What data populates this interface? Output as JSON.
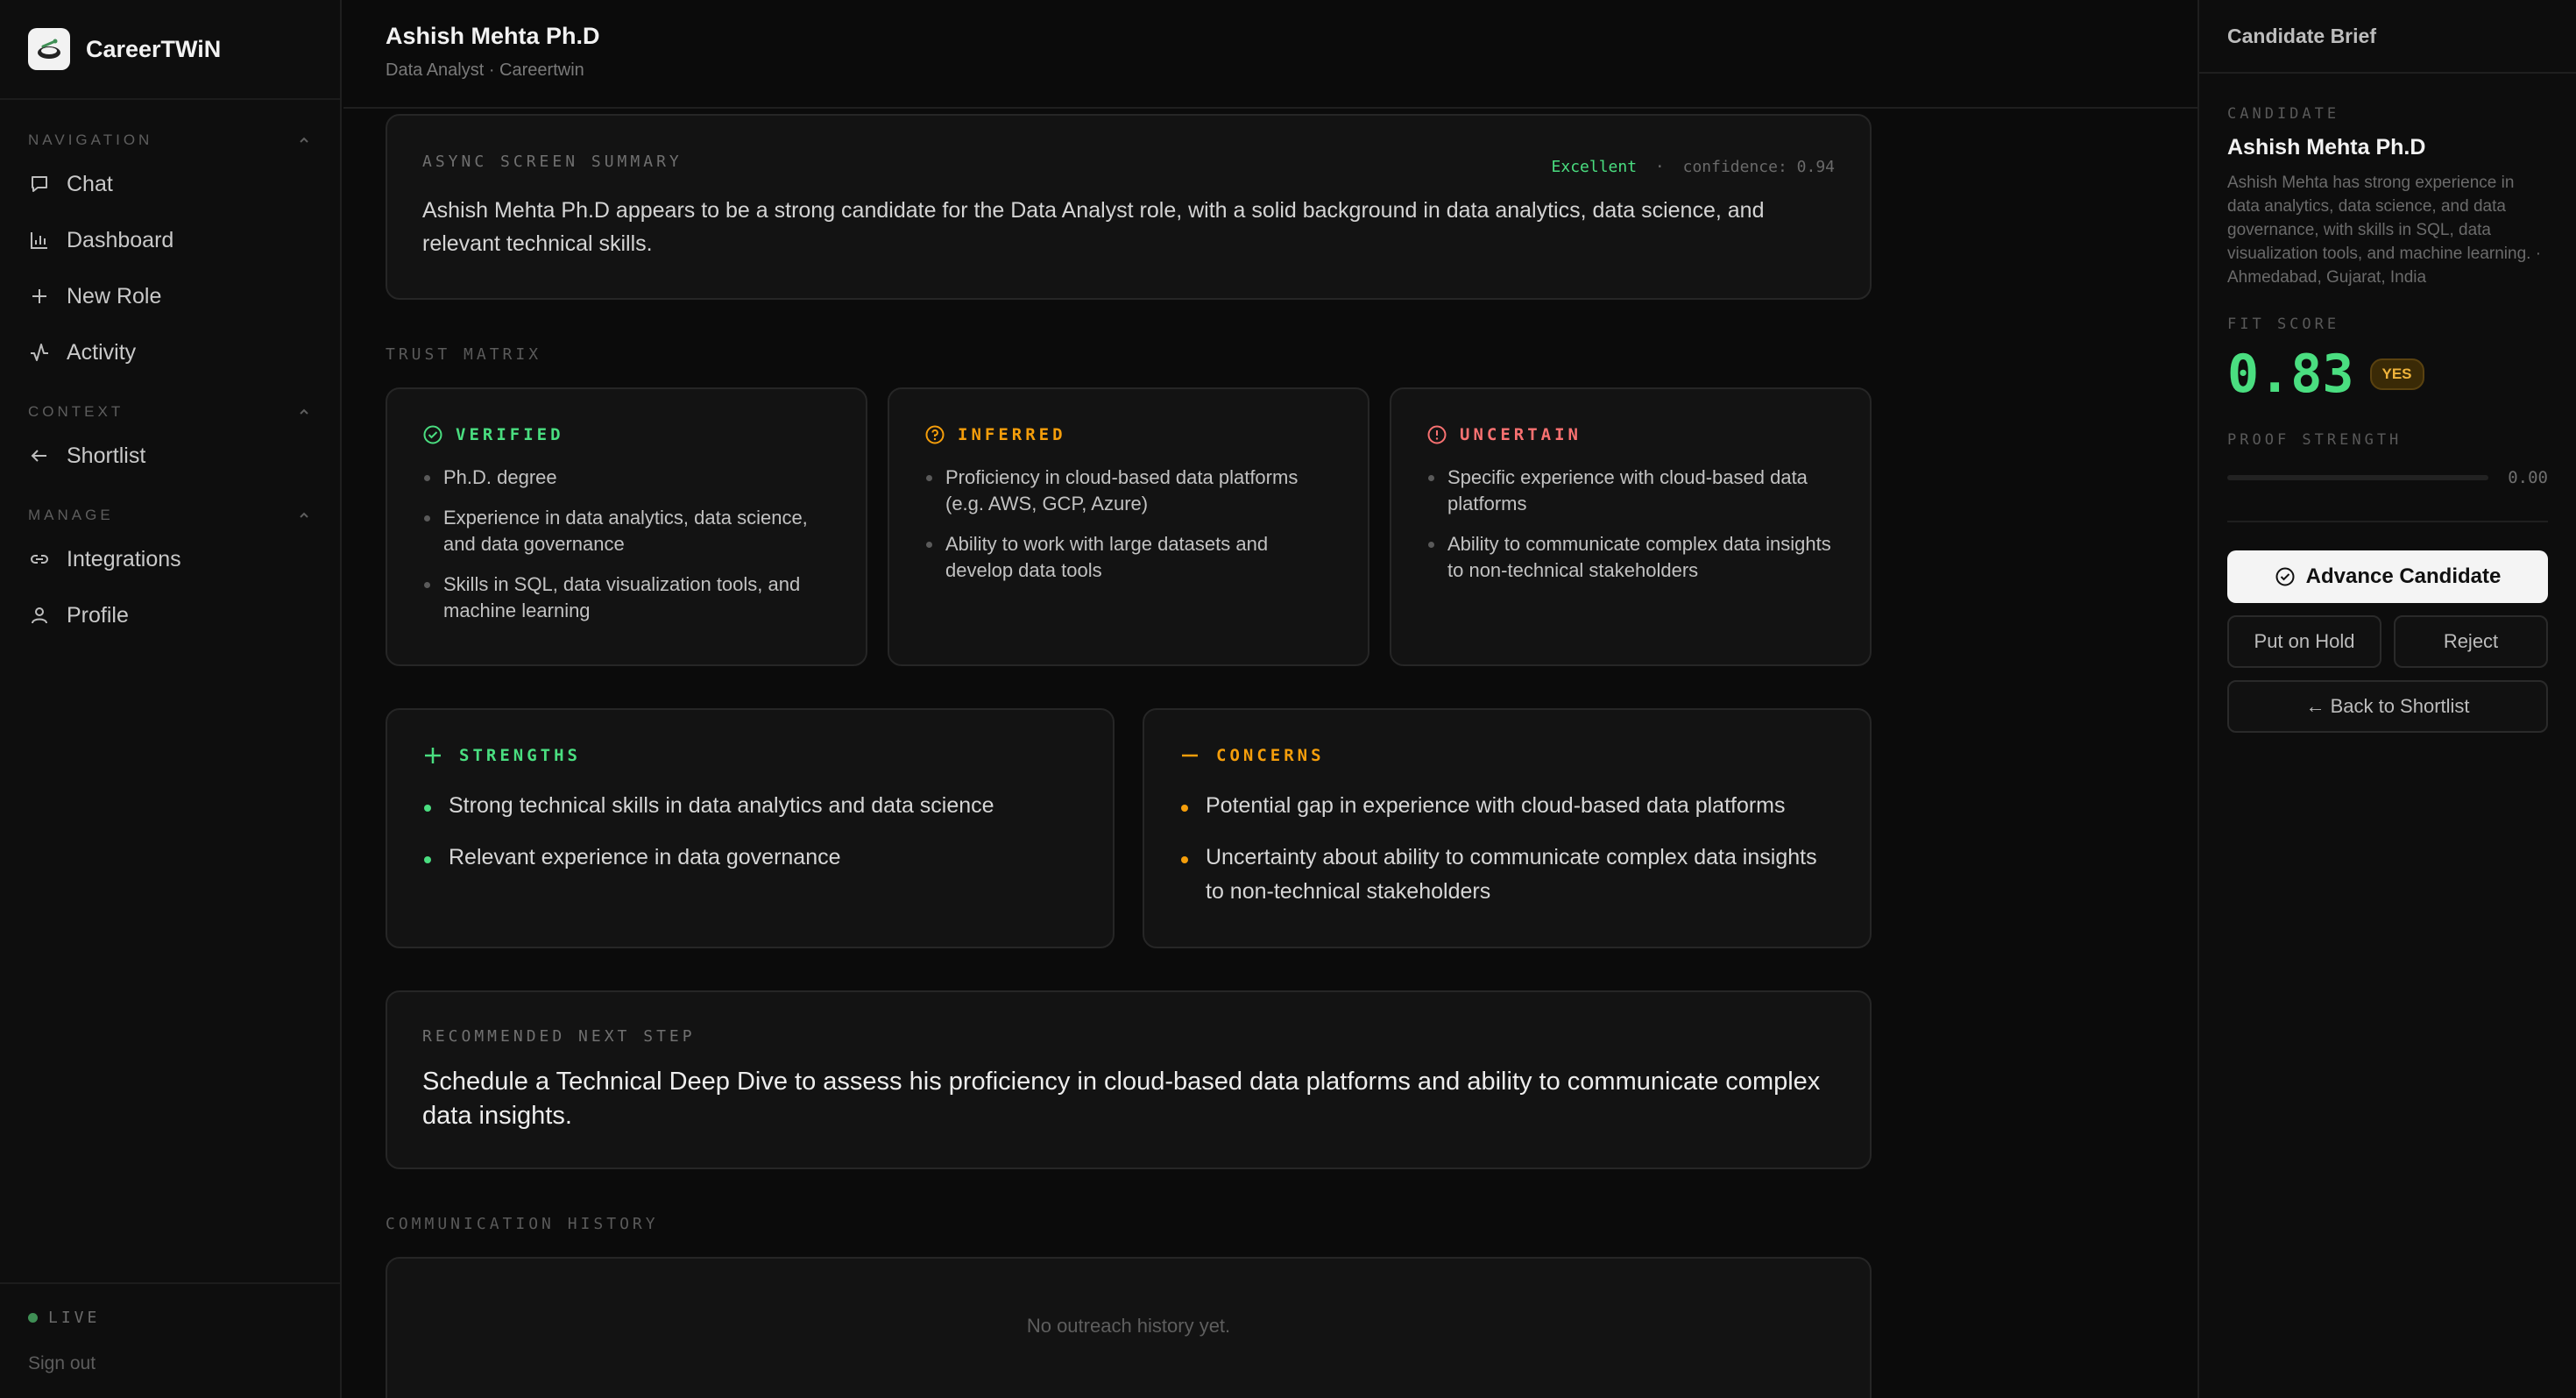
{
  "brand": {
    "name": "CareerTWiN"
  },
  "sidebar": {
    "navigation_label": "NAVIGATION",
    "nav_items": [
      {
        "label": "Chat",
        "icon": "chat-icon"
      },
      {
        "label": "Dashboard",
        "icon": "bar-chart-icon"
      },
      {
        "label": "New Role",
        "icon": "plus-icon"
      },
      {
        "label": "Activity",
        "icon": "activity-icon"
      }
    ],
    "context_label": "CONTEXT",
    "context_items": [
      {
        "label": "Shortlist",
        "icon": "arrow-left-icon"
      }
    ],
    "manage_label": "MANAGE",
    "manage_items": [
      {
        "label": "Integrations",
        "icon": "link-icon"
      },
      {
        "label": "Profile",
        "icon": "user-icon"
      }
    ],
    "live_label": "LIVE",
    "signout_label": "Sign out"
  },
  "header": {
    "name": "Ashish Mehta Ph.D",
    "subtitle": "Data Analyst · Careertwin"
  },
  "summary": {
    "label": "ASYNC SCREEN SUMMARY",
    "rating": "Excellent",
    "separator": "·",
    "confidence": "confidence: 0.94",
    "text": "Ashish Mehta Ph.D appears to be a strong candidate for the Data Analyst role, with a solid background in data analytics, data science, and relevant technical skills."
  },
  "trust_matrix": {
    "label": "TRUST MATRIX",
    "verified": {
      "title": "VERIFIED",
      "color": "#4ade80",
      "items": [
        "Ph.D. degree",
        "Experience in data analytics, data science, and data governance",
        "Skills in SQL, data visualization tools, and machine learning"
      ]
    },
    "inferred": {
      "title": "INFERRED",
      "color": "#f59e0b",
      "items": [
        "Proficiency in cloud-based data platforms (e.g. AWS, GCP, Azure)",
        "Ability to work with large datasets and develop data tools"
      ]
    },
    "uncertain": {
      "title": "UNCERTAIN",
      "color": "#f87171",
      "items": [
        "Specific experience with cloud-based data platforms",
        "Ability to communicate complex data insights to non-technical stakeholders"
      ]
    }
  },
  "strengths": {
    "title": "STRENGTHS",
    "color": "#4ade80",
    "items": [
      "Strong technical skills in data analytics and data science",
      "Relevant experience in data governance"
    ]
  },
  "concerns": {
    "title": "CONCERNS",
    "color": "#f59e0b",
    "items": [
      "Potential gap in experience with cloud-based data platforms",
      "Uncertainty about ability to communicate complex data insights to non-technical stakeholders"
    ]
  },
  "next_step": {
    "label": "RECOMMENDED NEXT STEP",
    "text": "Schedule a Technical Deep Dive to assess his proficiency in cloud-based data platforms and ability to communicate complex data insights."
  },
  "history": {
    "label": "COMMUNICATION HISTORY",
    "empty_text": "No outreach history yet."
  },
  "brief": {
    "title": "Candidate Brief",
    "candidate_label": "CANDIDATE",
    "name": "Ashish Mehta Ph.D",
    "description": "Ashish Mehta has strong experience in data analytics, data science, and data governance, with skills in SQL, data visualization tools, and machine learning. · Ahmedabad, Gujarat, India",
    "fit_label": "FIT SCORE",
    "fit_score": "0.83",
    "fit_badge": "YES",
    "proof_label": "PROOF STRENGTH",
    "proof_value": "0.00",
    "proof_fraction": 0,
    "advance_label": "Advance Candidate",
    "hold_label": "Put on Hold",
    "reject_label": "Reject",
    "back_label": "← Back to Shortlist"
  }
}
